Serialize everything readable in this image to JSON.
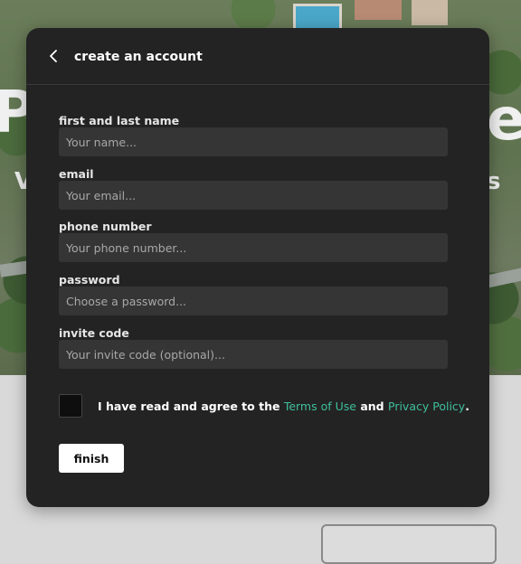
{
  "background": {
    "title_left": "P",
    "title_right": "es",
    "subtitle_left": "V",
    "subtitle_right": "s"
  },
  "modal": {
    "back_icon": "chevron-left-icon",
    "title": "create an account",
    "fields": {
      "name": {
        "label": "first and last name",
        "placeholder": "Your name..."
      },
      "email": {
        "label": "email",
        "placeholder": "Your email..."
      },
      "phone": {
        "label": "phone number",
        "placeholder": "Your phone number..."
      },
      "password": {
        "label": "password",
        "placeholder": "Choose a password..."
      },
      "invite": {
        "label": "invite code",
        "placeholder": "Your invite code (optional)..."
      }
    },
    "agreement": {
      "prefix": "I have read and agree to the",
      "terms": "Terms of Use",
      "and": "and",
      "privacy": "Privacy Policy",
      "suffix": "."
    },
    "finish_label": "finish"
  },
  "colors": {
    "modal_bg": "#232323",
    "input_bg": "#353535",
    "link": "#3fbf9a"
  }
}
